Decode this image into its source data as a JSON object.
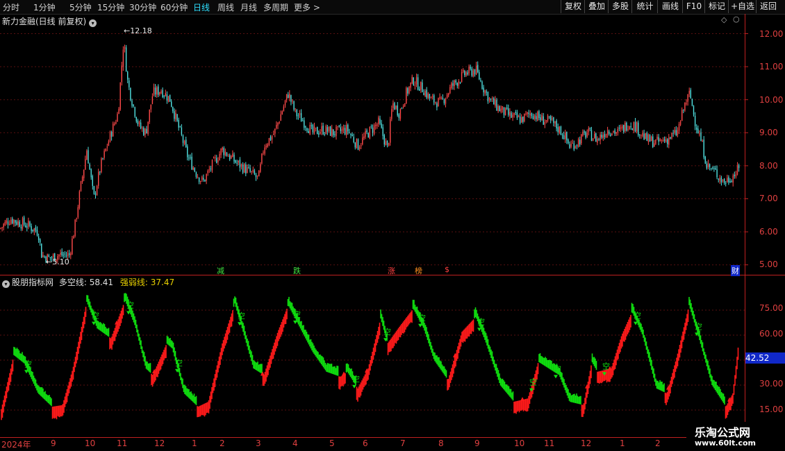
{
  "toolbar": {
    "periods": [
      "分时",
      "1分钟",
      "5分钟",
      "15分钟",
      "30分钟",
      "60分钟",
      "日线",
      "周线",
      "月线",
      "多周期",
      "更多 >"
    ],
    "active_period": "日线",
    "buttons": [
      "复权",
      "叠加",
      "多股",
      "统计",
      "画线",
      "F10",
      "标记",
      "+自选",
      "返回"
    ]
  },
  "main_chart": {
    "title": "新力金融(日线 前复权)",
    "y_ticks": [
      "12.00",
      "11.00",
      "10.00",
      "9.00",
      "8.00",
      "7.00",
      "6.00",
      "5.00"
    ],
    "high_label": "12.18",
    "low_label": "5.10",
    "events": [
      {
        "text": "减",
        "color": "#40e040"
      },
      {
        "text": "跌",
        "color": "#40e040"
      },
      {
        "text": "涨",
        "color": "#ff4040"
      },
      {
        "text": "榜",
        "color": "#ff9020"
      },
      {
        "text": "$",
        "color": "#ff4040"
      },
      {
        "text": "财",
        "color": "#ffffff"
      }
    ]
  },
  "indicator": {
    "name": "股朋指标网",
    "line1_label": "多空线: 58.41",
    "line2_label": "强弱线: 37.47",
    "y_ticks": [
      "75.00",
      "60.00",
      "45.00",
      "30.00",
      "15.00"
    ],
    "current_value": "42.52",
    "signal_text": "空",
    "colors": {
      "bull": "#ff1a1a",
      "bear": "#10e010",
      "label_bg": "#1028c8"
    }
  },
  "x_axis": {
    "ticks": [
      "2024年",
      "9",
      "10",
      "11",
      "12",
      "1",
      "2",
      "3",
      "4",
      "5",
      "6",
      "7",
      "8",
      "9",
      "10",
      "11",
      "12",
      "1",
      "2"
    ]
  },
  "watermark": {
    "line1": "乐淘公式网",
    "line2": "www.60lt.com"
  },
  "chart_data": [
    {
      "type": "candlestick",
      "title": "新力金融(日线 前复权)",
      "ylim": [
        5.0,
        12.3
      ],
      "x": [
        "2024-08",
        "2024-09",
        "2024-10",
        "2024-11",
        "2024-12",
        "2025-01",
        "2025-02",
        "2025-03",
        "2025-04",
        "2025-05",
        "2025-06",
        "2025-07",
        "2025-08",
        "2025-09",
        "2025-10",
        "2025-11",
        "2025-12",
        "2026-01",
        "2026-02"
      ],
      "close_approx": [
        6.2,
        5.3,
        8.0,
        11.2,
        9.8,
        8.2,
        7.6,
        9.0,
        10.3,
        9.0,
        8.6,
        10.0,
        10.3,
        10.8,
        9.4,
        9.0,
        9.0,
        8.8,
        10.0
      ],
      "annotations": [
        {
          "label": "12.18",
          "type": "high"
        },
        {
          "label": "5.10",
          "type": "low"
        }
      ]
    },
    {
      "type": "area",
      "title": "股朋指标网",
      "ylim": [
        0,
        90
      ],
      "series": [
        {
          "name": "多空线",
          "last": 58.41
        },
        {
          "name": "强弱线",
          "last": 37.47
        }
      ],
      "current": 42.52
    }
  ]
}
